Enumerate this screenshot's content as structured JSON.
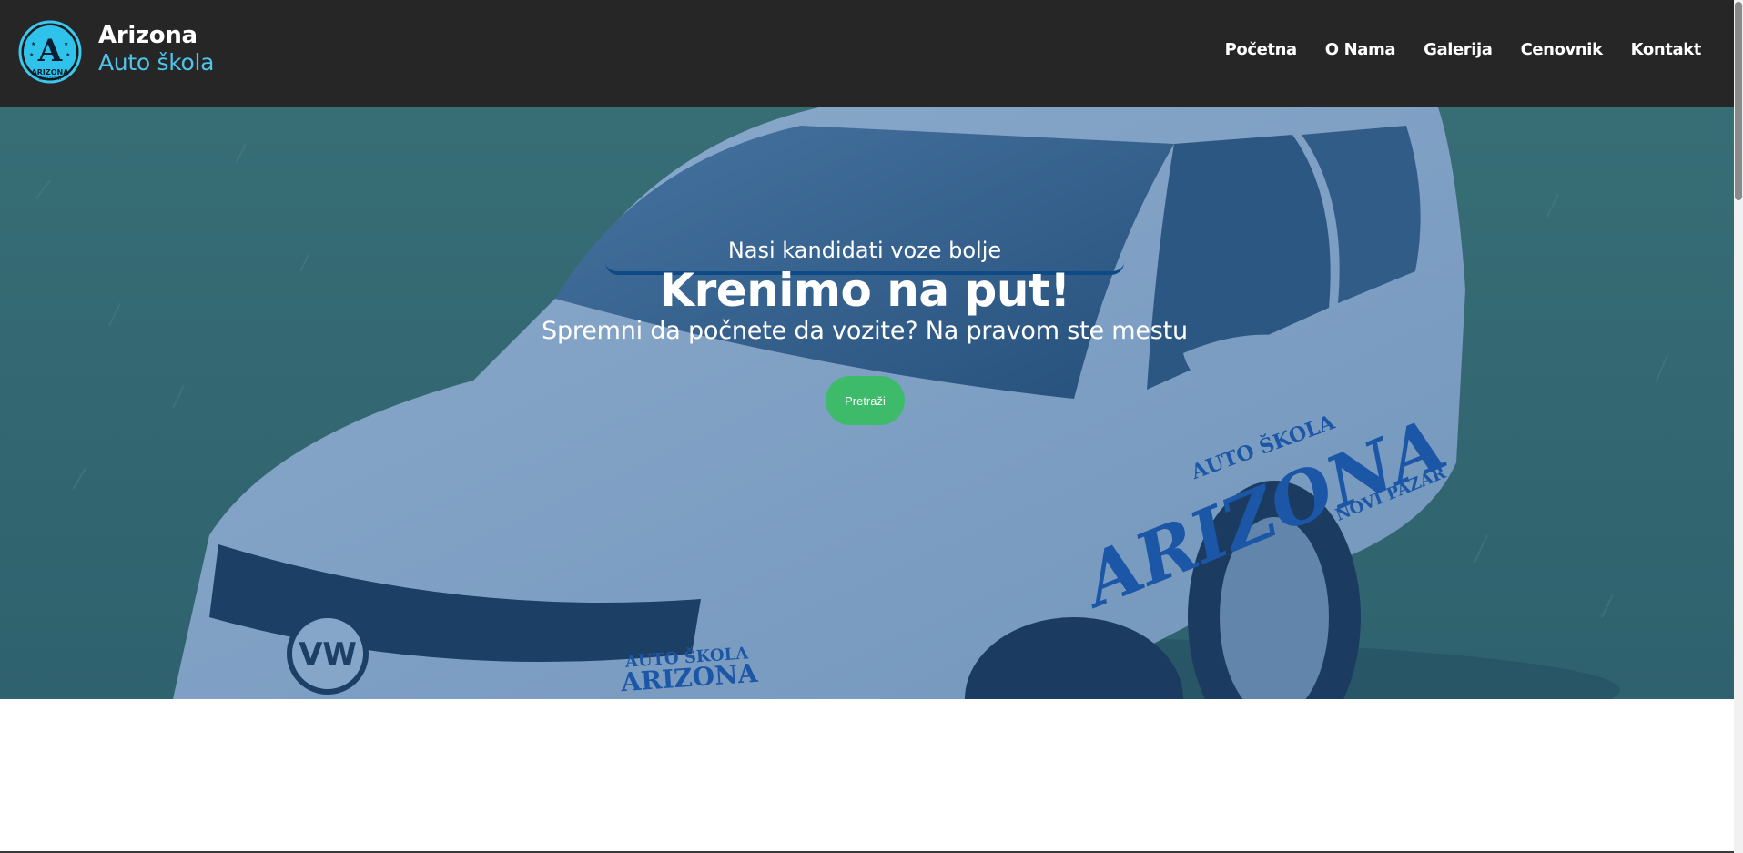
{
  "brand": {
    "name": "Arizona",
    "subtitle": "Auto škola",
    "logo_icon": "arizona-logo-icon",
    "logo_text": "ARIZONA",
    "logo_letter": "A",
    "logo_subtext": "NOVI PAZAR"
  },
  "nav": {
    "items": [
      {
        "label": "Početna"
      },
      {
        "label": "O Nama"
      },
      {
        "label": "Galerija"
      },
      {
        "label": "Cenovnik"
      },
      {
        "label": "Kontakt"
      }
    ]
  },
  "hero": {
    "eyebrow": "Nasi kandidati voze bolje",
    "title": "Krenimo na put!",
    "subtitle": "Spremni da počnete da vozite? Na pravom ste mestu",
    "cta_label": "Pretraži",
    "car_text": {
      "door_top": "AUTO ŠKOLA",
      "door_main": "ARIZONA",
      "door_bottom": "NOVI PAZAR",
      "hood_top": "AUTO ŠKOLA",
      "hood_main": "ARIZONA"
    }
  },
  "colors": {
    "header_bg": "#262626",
    "accent": "#4fc3e8",
    "cta": "#3dba6a",
    "overlay": "#1c589b"
  }
}
